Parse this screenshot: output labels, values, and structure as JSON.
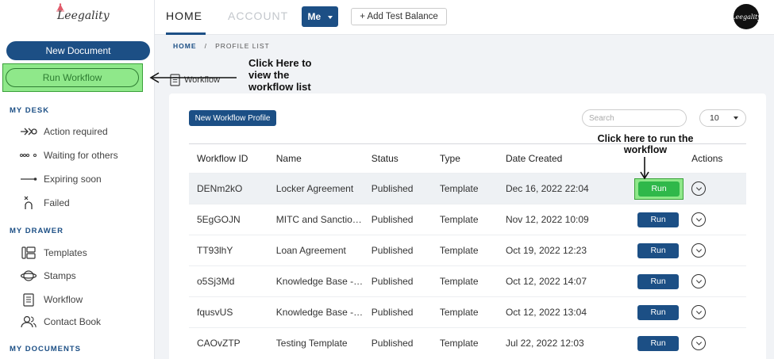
{
  "app": {
    "logo_text": "Leegality"
  },
  "sidebar": {
    "new_document": "New Document",
    "run_workflow": "Run Workflow",
    "sections": {
      "my_desk": "MY DESK",
      "my_drawer": "MY DRAWER",
      "my_documents": "MY DOCUMENTS"
    },
    "my_desk_items": [
      {
        "label": "Action required",
        "icon": "action-required-icon"
      },
      {
        "label": "Waiting for others",
        "icon": "waiting-icon"
      },
      {
        "label": "Expiring soon",
        "icon": "expiring-icon"
      },
      {
        "label": "Failed",
        "icon": "failed-icon"
      }
    ],
    "my_drawer_items": [
      {
        "label": "Templates",
        "icon": "templates-icon"
      },
      {
        "label": "Stamps",
        "icon": "stamps-icon"
      },
      {
        "label": "Workflow",
        "icon": "workflow-icon"
      },
      {
        "label": "Contact Book",
        "icon": "contact-book-icon"
      }
    ]
  },
  "topbar": {
    "tab_home": "HOME",
    "tab_account": "ACCOUNT",
    "me_label": "Me",
    "add_balance": "+ Add Test Balance",
    "avatar_text": "Leegality"
  },
  "breadcrumb": {
    "home": "HOME",
    "sep": "/",
    "current": "PROFILE LIST"
  },
  "page": {
    "title": "Workflow"
  },
  "toolbar": {
    "new_profile": "New Workflow Profile",
    "search_placeholder": "Search",
    "page_size": "10"
  },
  "table": {
    "headers": [
      "Workflow ID",
      "Name",
      "Status",
      "Type",
      "Date Created",
      "",
      "Actions"
    ],
    "run_label": "Run",
    "rows": [
      {
        "id": "DENm2kO",
        "name": "Locker Agreement",
        "status": "Published",
        "type": "Template",
        "date": "Dec 16, 2022 22:04"
      },
      {
        "id": "5EgGOJN",
        "name": "MITC and Sanctio…",
        "status": "Published",
        "type": "Template",
        "date": "Nov 12, 2022 10:09"
      },
      {
        "id": "TT93lhY",
        "name": "Loan Agreement",
        "status": "Published",
        "type": "Template",
        "date": "Oct 19, 2022 12:23"
      },
      {
        "id": "o5Sj3Md",
        "name": "Knowledge Base - …",
        "status": "Published",
        "type": "Template",
        "date": "Oct 12, 2022 14:07"
      },
      {
        "id": "fqusvUS",
        "name": "Knowledge Base - …",
        "status": "Published",
        "type": "Template",
        "date": "Oct 12, 2022 13:04"
      },
      {
        "id": "CAOvZTP",
        "name": "Testing Template",
        "status": "Published",
        "type": "Template",
        "date": "Jul 22, 2022 12:03"
      }
    ]
  },
  "annotations": {
    "view_list": [
      "Click Here to",
      "view the",
      "workflow list"
    ],
    "run_workflow": [
      "Click here to run the",
      "workflow"
    ]
  },
  "colors": {
    "brand": "#1c4f85",
    "highlight": "#8fe88a",
    "run_green": "#2fb84a"
  }
}
